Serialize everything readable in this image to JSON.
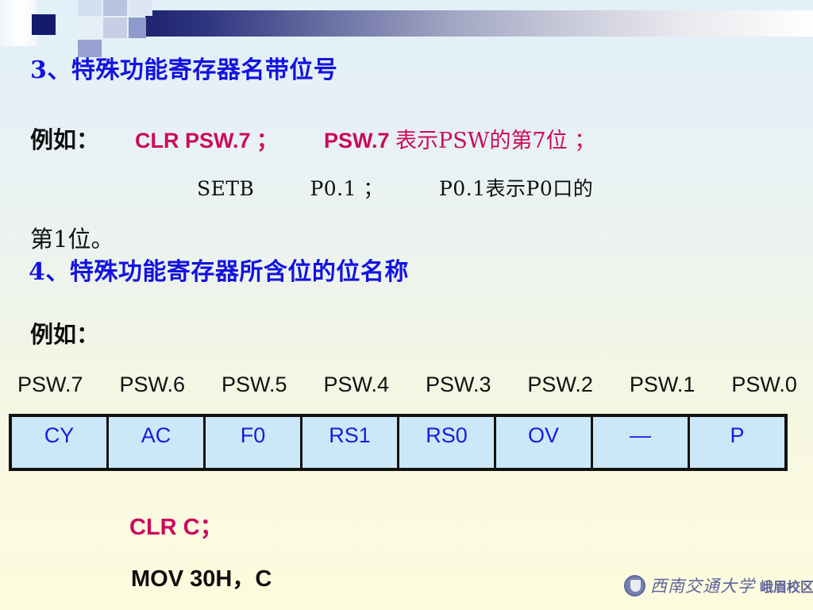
{
  "slide": {
    "background_top_color": "#e2f0f8",
    "background_bottom_color": "#fdfbdd",
    "header_bar_dark_color": "#1f2470"
  },
  "section3": {
    "heading": "3、特殊功能寄存器名带位号",
    "example_label": "例如：",
    "instruction_1": "CLR  PSW.7 ；",
    "meaning_1_bold": "PSW.7 ",
    "meaning_1_rest": "表示PSW的第7位 ；",
    "instruction_2": "SETB",
    "operand_2": "P0.1 ；",
    "meaning_2": "P0.1表示P0口的",
    "meaning_2_cont": "第1位。"
  },
  "section4": {
    "heading": "4、特殊功能寄存器所含位的位名称",
    "example_label": "例如：",
    "bit_indexes": [
      "PSW.7",
      "PSW.6",
      "PSW.5",
      "PSW.4",
      "PSW.3",
      "PSW.2",
      "PSW.1",
      "PSW.0"
    ],
    "bit_names": [
      "CY",
      "AC",
      "F0",
      "RS1",
      "RS0",
      "OV",
      "—",
      "P"
    ],
    "table_cell_bg": "#cce8f8",
    "table_text_color": "#1a1ae0",
    "instruction_clr": "CLR  C；",
    "instruction_mov": "MOV  30H，C"
  },
  "logo": {
    "university": "西南交通大学",
    "campus": "峨眉校区"
  }
}
